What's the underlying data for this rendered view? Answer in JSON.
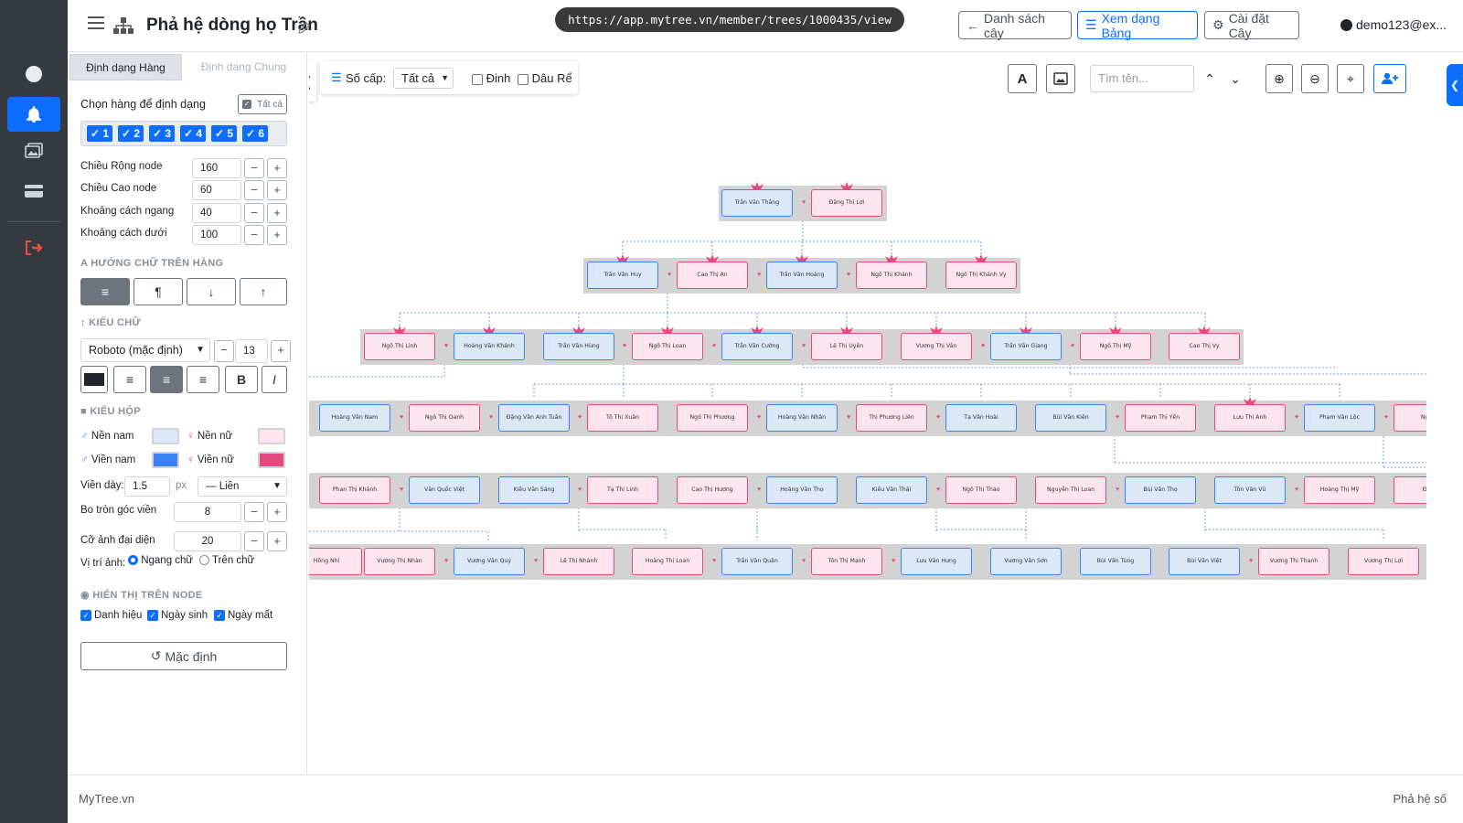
{
  "sidebar": {
    "items": [
      {
        "icon": "circle-icon"
      },
      {
        "icon": "bell-icon"
      },
      {
        "icon": "images-icon"
      },
      {
        "icon": "card-icon"
      },
      {
        "icon": "logout-icon"
      }
    ]
  },
  "header": {
    "title": "Phả hệ dòng họ Trần",
    "url": "https://app.mytree.vn/member/trees/1000435/view",
    "btn_list": "Danh sách cây",
    "btn_table": "Xem dạng Bảng",
    "btn_settings": "Cài đặt Cây",
    "user": "demo123@ex..."
  },
  "panel": {
    "tab_row": "Định dạng Hàng",
    "tab_general": "Định dạng Chung",
    "select_rows_label": "Chọn hàng để định dạng",
    "select_all": "Tất cả",
    "rows": [
      "1",
      "2",
      "3",
      "4",
      "5",
      "6"
    ],
    "node_width_label": "Chiều Rộng node",
    "node_width": "160",
    "node_height_label": "Chiều Cao node",
    "node_height": "60",
    "hgap_label": "Khoảng cách ngang",
    "hgap": "40",
    "vgap_label": "Khoảng cách dưới",
    "vgap": "100",
    "text_dir_title": "HƯỚNG CHỮ TRÊN HÀNG",
    "font_title": "KIỂU CHỮ",
    "font": "Roboto (mặc định)",
    "font_size": "13",
    "bold": "B",
    "italic": "I",
    "box_title": "KIỂU HỘP",
    "male_bg_label": "Nền nam",
    "female_bg_label": "Nền nữ",
    "male_border_label": "Viền nam",
    "female_border_label": "Viền nữ",
    "male_bg": "#dbe8f8",
    "female_bg": "#fde4ee",
    "male_border": "#3b82f6",
    "female_border": "#e64980",
    "border_w_label": "Viền dày:",
    "border_w": "1.5",
    "px": "px",
    "border_style": "— Liền",
    "radius_label": "Bo tròn góc viền",
    "radius": "8",
    "avatar_label": "Cỡ ảnh đại diện",
    "avatar": "20",
    "img_pos_label": "Vị trí ảnh:",
    "img_pos_h": "Ngang chữ",
    "img_pos_top": "Trên chữ",
    "display_title": "HIỂN THỊ TRÊN NODE",
    "show_title": "Danh hiệu",
    "show_birth": "Ngày sinh",
    "show_death": "Ngày mất",
    "reset": "Mặc định"
  },
  "toolbar": {
    "levels_label": "Số cấp:",
    "levels_value": "Tất cả",
    "pin_label": "Đinh",
    "inlaw_label": "Dâu Rể",
    "search_placeholder": "Tìm tên..."
  },
  "tree": {
    "gen1": [
      {
        "n": "Trần Văn Thắng",
        "s": "m"
      },
      {
        "n": "Đặng Thị Lợi",
        "s": "f"
      }
    ],
    "gen2": [
      {
        "n": "Trần Văn Huy",
        "s": "m"
      },
      {
        "n": "Cao Thị An",
        "s": "f"
      },
      {
        "n": "Trần Văn Hoàng",
        "s": "m"
      },
      {
        "n": "Ngô Thị Khánh",
        "s": "f"
      },
      {
        "n": "Ngô Thị Khánh Vy",
        "s": "f"
      }
    ],
    "gen3": [
      {
        "n": "Ngô Thị Linh",
        "s": "f"
      },
      {
        "n": "Hoàng Văn Khánh",
        "s": "m"
      },
      {
        "n": "Trần Văn Hùng",
        "s": "m"
      },
      {
        "n": "Ngô Thị Loan",
        "s": "f"
      },
      {
        "n": "Trần Văn Cường",
        "s": "m"
      },
      {
        "n": "Lê Thị Uyên",
        "s": "f"
      },
      {
        "n": "Vương Thị Vân",
        "s": "f"
      },
      {
        "n": "Trần Văn Giang",
        "s": "m"
      },
      {
        "n": "Ngô Thị Mỹ",
        "s": "f"
      },
      {
        "n": "Cao Thị Vy",
        "s": "f"
      }
    ],
    "gen4": [
      {
        "n": "Hoàng Văn Nam",
        "s": "m"
      },
      {
        "n": "Ngô Thị Oanh",
        "s": "f"
      },
      {
        "n": "Đặng Văn Anh Tuấn",
        "s": "m"
      },
      {
        "n": "Tô Thị Xuân",
        "s": "f"
      },
      {
        "n": "Ngô Thị Phương",
        "s": "f"
      },
      {
        "n": "Hoàng Văn Nhân",
        "s": "m"
      },
      {
        "n": "Thị Phương Liên",
        "s": "f"
      },
      {
        "n": "Tạ Văn Hoài",
        "s": "m"
      },
      {
        "n": "Bùi Văn Kiên",
        "s": "m"
      },
      {
        "n": "Phạm Thị Yến",
        "s": "f"
      },
      {
        "n": "Lưu Thị Anh",
        "s": "f"
      },
      {
        "n": "Phạm Văn Lộc",
        "s": "m"
      },
      {
        "n": "Ngô T",
        "s": "f"
      }
    ],
    "gen5": [
      {
        "n": "Phan Thị Khánh",
        "s": "f"
      },
      {
        "n": "Văn Quốc Việt",
        "s": "m"
      },
      {
        "n": "Kiều Văn Sáng",
        "s": "m"
      },
      {
        "n": "Tạ Thị Linh",
        "s": "f"
      },
      {
        "n": "Cao Thị Hương",
        "s": "f"
      },
      {
        "n": "Hoàng Văn Thọ",
        "s": "m"
      },
      {
        "n": "Kiều Văn Thái",
        "s": "m"
      },
      {
        "n": "Ngô Thị Thảo",
        "s": "f"
      },
      {
        "n": "Nguyễn Thị Loan",
        "s": "f"
      },
      {
        "n": "Bùi Văn Thọ",
        "s": "m"
      },
      {
        "n": "Tôn Văn Vũ",
        "s": "m"
      },
      {
        "n": "Hoàng Thị Mỹ",
        "s": "f"
      },
      {
        "n": "Đỗ T",
        "s": "f"
      }
    ],
    "gen6": [
      {
        "n": "Hồng Nhi",
        "s": "f"
      },
      {
        "n": "Vương Thị Nhàn",
        "s": "f"
      },
      {
        "n": "Vương Văn Quý",
        "s": "m"
      },
      {
        "n": "Lê Thị Nhành",
        "s": "f"
      },
      {
        "n": "Hoàng Thị Loan",
        "s": "f"
      },
      {
        "n": "Trần Văn Quân",
        "s": "m"
      },
      {
        "n": "Tôn Thị Mạnh",
        "s": "f"
      },
      {
        "n": "Lưu Văn Hưng",
        "s": "m"
      },
      {
        "n": "Vương Văn Sơn",
        "s": "m"
      },
      {
        "n": "Bùi Văn Tùng",
        "s": "m"
      },
      {
        "n": "Bùi Văn Việt",
        "s": "m"
      },
      {
        "n": "Vương Thị Thanh",
        "s": "f"
      },
      {
        "n": "Vương Thị Lợi",
        "s": "f"
      }
    ]
  },
  "footer": {
    "left": "MyTree.vn",
    "right": "Phả hệ số"
  }
}
